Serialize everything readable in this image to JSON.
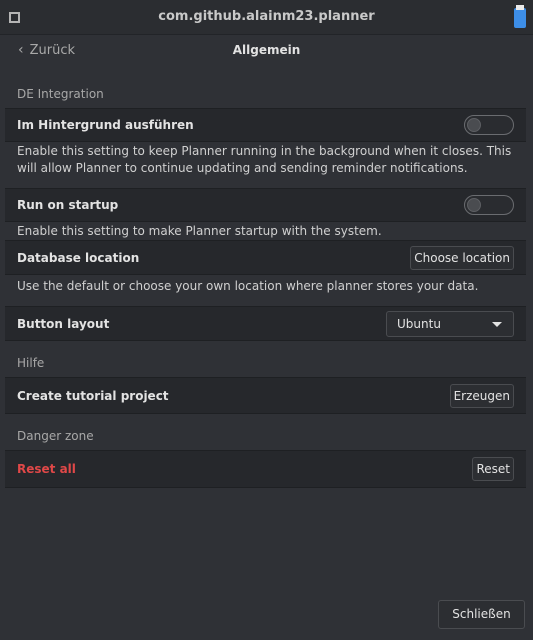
{
  "window": {
    "title": "com.github.alainm23.planner"
  },
  "header": {
    "back_label": "Zurück",
    "title": "Allgemein"
  },
  "sections": {
    "de_integration": {
      "title": "DE Integration"
    },
    "help": {
      "title": "Hilfe"
    },
    "danger": {
      "title": "Danger zone"
    }
  },
  "settings": {
    "background": {
      "label": "Im Hintergrund ausführen",
      "enabled": false,
      "description": "Enable this setting to keep Planner running in the background when it closes. This will allow Planner to continue updating and sending reminder notifications."
    },
    "startup": {
      "label": "Run on startup",
      "enabled": false,
      "description": "Enable this setting to make Planner startup with the system."
    },
    "database": {
      "label": "Database location",
      "button": "Choose location",
      "description": "Use the default or choose your own location where planner stores your data."
    },
    "button_layout": {
      "label": "Button layout",
      "selected": "Ubuntu"
    },
    "tutorial": {
      "label": "Create tutorial project",
      "button": "Erzeugen"
    },
    "reset": {
      "label": "Reset all",
      "button": "Reset"
    }
  },
  "footer": {
    "close_label": "Schließen"
  },
  "colors": {
    "danger": "#e04848",
    "background": "#2f3136",
    "row": "#26282c"
  }
}
